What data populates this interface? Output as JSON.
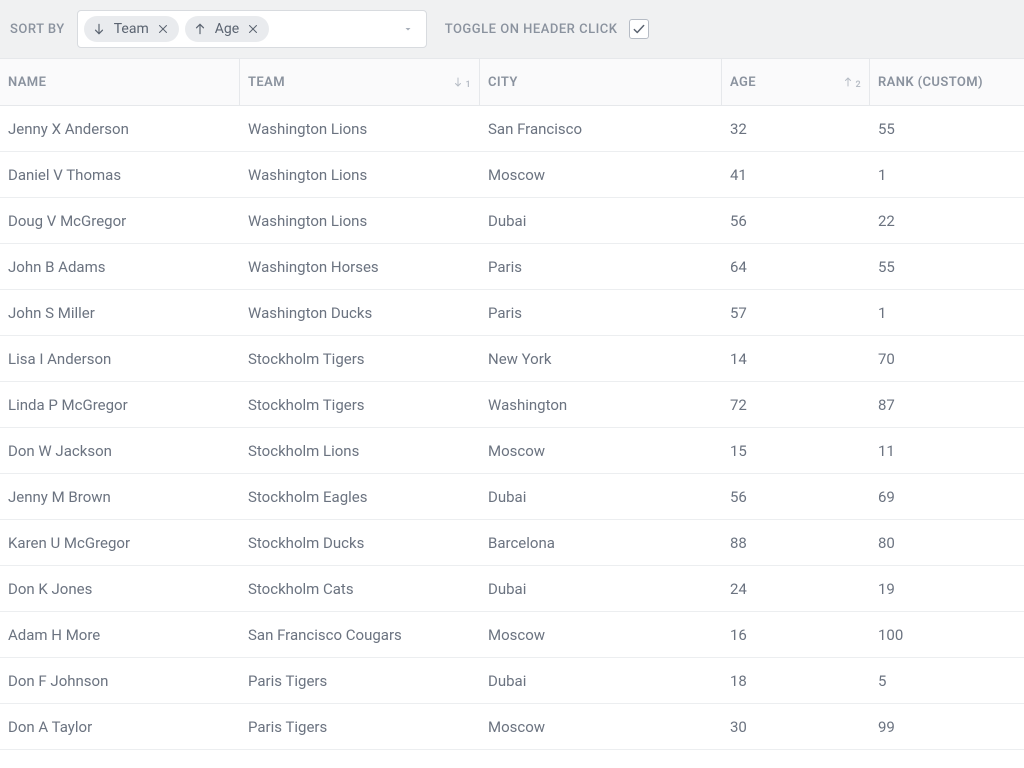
{
  "toolbar": {
    "sortby_label": "SORT BY",
    "toggle_label": "TOGGLE ON HEADER CLICK",
    "toggle_checked": true,
    "chips": [
      {
        "label": "Team",
        "direction": "desc"
      },
      {
        "label": "Age",
        "direction": "asc"
      }
    ]
  },
  "columns": [
    {
      "key": "name",
      "label": "NAME",
      "sort": null
    },
    {
      "key": "team",
      "label": "TEAM",
      "sort": {
        "direction": "desc",
        "order": 1
      }
    },
    {
      "key": "city",
      "label": "CITY",
      "sort": null
    },
    {
      "key": "age",
      "label": "AGE",
      "sort": {
        "direction": "asc",
        "order": 2
      }
    },
    {
      "key": "rank",
      "label": "RANK (CUSTOM)",
      "sort": null
    }
  ],
  "rows": [
    {
      "name": "Jenny X Anderson",
      "team": "Washington Lions",
      "city": "San Francisco",
      "age": "32",
      "rank": "55"
    },
    {
      "name": "Daniel V Thomas",
      "team": "Washington Lions",
      "city": "Moscow",
      "age": "41",
      "rank": "1"
    },
    {
      "name": "Doug V McGregor",
      "team": "Washington Lions",
      "city": "Dubai",
      "age": "56",
      "rank": "22"
    },
    {
      "name": "John B Adams",
      "team": "Washington Horses",
      "city": "Paris",
      "age": "64",
      "rank": "55"
    },
    {
      "name": "John S Miller",
      "team": "Washington Ducks",
      "city": "Paris",
      "age": "57",
      "rank": "1"
    },
    {
      "name": "Lisa I Anderson",
      "team": "Stockholm Tigers",
      "city": "New York",
      "age": "14",
      "rank": "70"
    },
    {
      "name": "Linda P McGregor",
      "team": "Stockholm Tigers",
      "city": "Washington",
      "age": "72",
      "rank": "87"
    },
    {
      "name": "Don W Jackson",
      "team": "Stockholm Lions",
      "city": "Moscow",
      "age": "15",
      "rank": "11"
    },
    {
      "name": "Jenny M Brown",
      "team": "Stockholm Eagles",
      "city": "Dubai",
      "age": "56",
      "rank": "69"
    },
    {
      "name": "Karen U McGregor",
      "team": "Stockholm Ducks",
      "city": "Barcelona",
      "age": "88",
      "rank": "80"
    },
    {
      "name": "Don K Jones",
      "team": "Stockholm Cats",
      "city": "Dubai",
      "age": "24",
      "rank": "19"
    },
    {
      "name": "Adam H More",
      "team": "San Francisco Cougars",
      "city": "Moscow",
      "age": "16",
      "rank": "100"
    },
    {
      "name": "Don F Johnson",
      "team": "Paris Tigers",
      "city": "Dubai",
      "age": "18",
      "rank": "5"
    },
    {
      "name": "Don A Taylor",
      "team": "Paris Tigers",
      "city": "Moscow",
      "age": "30",
      "rank": "99"
    }
  ]
}
